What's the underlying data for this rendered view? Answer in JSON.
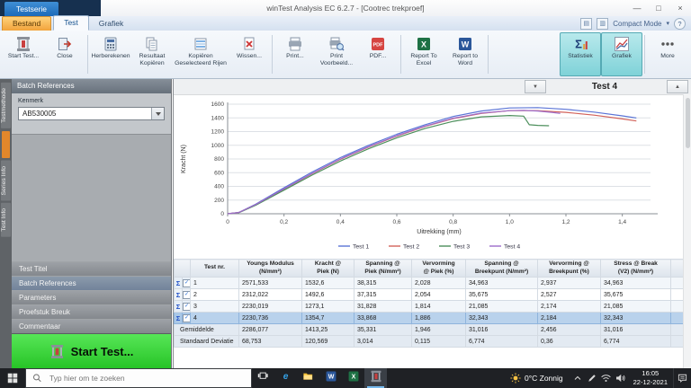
{
  "window": {
    "doc_tab": "Testserie",
    "title": "winTest Analysis EC 6.2.7 - [Cootrec trekproef]",
    "controls": {
      "minimize": "—",
      "maximize": "□",
      "close": "×"
    }
  },
  "ribbon": {
    "tabs": [
      {
        "id": "bestand",
        "label": "Bestand",
        "style": "file"
      },
      {
        "id": "test",
        "label": "Test",
        "active": true
      },
      {
        "id": "grafiek",
        "label": "Grafiek"
      }
    ],
    "right": {
      "compact_mode": "Compact Mode"
    },
    "groups": [
      {
        "buttons": [
          {
            "id": "start-test",
            "label": "Start Test...",
            "icon": "machine"
          },
          {
            "id": "close",
            "label": "Close",
            "icon": "close"
          }
        ]
      },
      {
        "buttons": [
          {
            "id": "herberekenen",
            "label": "Herberekenen",
            "icon": "recalc"
          },
          {
            "id": "resultaat-kopieren",
            "label": "Resultaat Kopiëren",
            "icon": "copy"
          },
          {
            "id": "kopieren-geselecteerd-rijen",
            "label": "Kopiëren Geselecteerd Rijen",
            "icon": "copy-rows"
          },
          {
            "id": "wissen",
            "label": "Wissen...",
            "icon": "delete"
          }
        ]
      },
      {
        "buttons": [
          {
            "id": "print",
            "label": "Print...",
            "icon": "printer"
          },
          {
            "id": "print-voorbeeld",
            "label": "Print Voorbeeld...",
            "icon": "print-preview"
          },
          {
            "id": "pdf",
            "label": "PDF...",
            "icon": "pdf"
          }
        ]
      },
      {
        "buttons": [
          {
            "id": "report-to-excel",
            "label": "Report To Excel",
            "icon": "excel"
          },
          {
            "id": "report-to-word",
            "label": "Report to Word",
            "icon": "word"
          }
        ]
      },
      {
        "buttons": [
          {
            "id": "statistiek",
            "label": "Statistiek",
            "icon": "sigma",
            "active": true
          },
          {
            "id": "grafiek",
            "label": "Grafiek",
            "icon": "chart",
            "active": true
          }
        ]
      },
      {
        "buttons": [
          {
            "id": "more",
            "label": "More",
            "icon": "more"
          }
        ]
      }
    ]
  },
  "side_tabs": {
    "items": [
      {
        "label": "Testmethode"
      },
      {
        "label": "Series Info"
      },
      {
        "label": "Test Info"
      }
    ]
  },
  "left_panel": {
    "header": "Batch References",
    "kenmerk_label": "Kenmerk",
    "kenmerk_value": "AB530005",
    "nav_items": [
      {
        "label": "Test Titel"
      },
      {
        "label": "Batch References",
        "active": true
      },
      {
        "label": "Parameters"
      },
      {
        "label": "Proefstuk Breuk"
      },
      {
        "label": "Commentaar"
      }
    ],
    "start_button": "Start Test..."
  },
  "main": {
    "selected_test": "Test 4",
    "dropdown_icon": "▼",
    "collapse_icon": "▲"
  },
  "chart_data": {
    "type": "line",
    "xlabel": "Uitrekking (mm)",
    "ylabel": "Kracht (N)",
    "xlim": [
      0,
      1.5
    ],
    "ylim": [
      0,
      1600
    ],
    "grid": "horizontal",
    "legend_position": "bottom",
    "x_ticks": [
      0,
      0.2,
      0.4,
      0.6,
      0.8,
      1.0,
      1.2,
      1.4
    ],
    "x_tick_labels": [
      "0",
      "0,2",
      "0,4",
      "0,6",
      "0,8",
      "1,0",
      "1,2",
      "1,4"
    ],
    "y_ticks": [
      0,
      200,
      400,
      600,
      800,
      1000,
      1200,
      1400,
      1600
    ],
    "series": [
      {
        "name": "Test 1",
        "color": "#5b74d6",
        "points": [
          [
            0,
            0
          ],
          [
            0.04,
            20
          ],
          [
            0.1,
            140
          ],
          [
            0.2,
            380
          ],
          [
            0.3,
            610
          ],
          [
            0.4,
            820
          ],
          [
            0.5,
            1000
          ],
          [
            0.6,
            1160
          ],
          [
            0.7,
            1300
          ],
          [
            0.8,
            1420
          ],
          [
            0.9,
            1500
          ],
          [
            1.0,
            1545
          ],
          [
            1.1,
            1550
          ],
          [
            1.2,
            1525
          ],
          [
            1.3,
            1485
          ],
          [
            1.4,
            1430
          ],
          [
            1.45,
            1400
          ]
        ]
      },
      {
        "name": "Test 2",
        "color": "#d2625a",
        "points": [
          [
            0,
            0
          ],
          [
            0.04,
            18
          ],
          [
            0.1,
            130
          ],
          [
            0.2,
            360
          ],
          [
            0.3,
            585
          ],
          [
            0.4,
            795
          ],
          [
            0.5,
            975
          ],
          [
            0.6,
            1135
          ],
          [
            0.7,
            1275
          ],
          [
            0.8,
            1390
          ],
          [
            0.9,
            1465
          ],
          [
            1.0,
            1505
          ],
          [
            1.1,
            1505
          ],
          [
            1.2,
            1480
          ],
          [
            1.3,
            1440
          ],
          [
            1.4,
            1385
          ],
          [
            1.45,
            1355
          ]
        ]
      },
      {
        "name": "Test 3",
        "color": "#4d8f5c",
        "points": [
          [
            0,
            0
          ],
          [
            0.04,
            16
          ],
          [
            0.1,
            125
          ],
          [
            0.2,
            345
          ],
          [
            0.3,
            565
          ],
          [
            0.4,
            770
          ],
          [
            0.5,
            950
          ],
          [
            0.6,
            1110
          ],
          [
            0.7,
            1245
          ],
          [
            0.8,
            1350
          ],
          [
            0.9,
            1415
          ],
          [
            1.0,
            1435
          ],
          [
            1.05,
            1425
          ],
          [
            1.07,
            1300
          ],
          [
            1.1,
            1290
          ],
          [
            1.14,
            1285
          ]
        ]
      },
      {
        "name": "Test 4",
        "color": "#9d6bc9",
        "points": [
          [
            0,
            0
          ],
          [
            0.04,
            18
          ],
          [
            0.1,
            135
          ],
          [
            0.2,
            365
          ],
          [
            0.3,
            590
          ],
          [
            0.4,
            800
          ],
          [
            0.5,
            980
          ],
          [
            0.6,
            1140
          ],
          [
            0.7,
            1280
          ],
          [
            0.8,
            1395
          ],
          [
            0.9,
            1470
          ],
          [
            1.0,
            1505
          ],
          [
            1.05,
            1510
          ],
          [
            1.1,
            1500
          ],
          [
            1.15,
            1480
          ],
          [
            1.18,
            1465
          ]
        ]
      }
    ]
  },
  "table": {
    "columns": [
      {
        "title": "Test nr.",
        "unit": ""
      },
      {
        "title": "Youngs Modulus",
        "unit": "(N/mm²)"
      },
      {
        "title": "Kracht @",
        "unit": "Piek (N)"
      },
      {
        "title": "Spanning @",
        "unit": "Piek (N/mm²)"
      },
      {
        "title": "Vervorming",
        "unit": "@ Piek (%)"
      },
      {
        "title": "Spanning @",
        "unit": "Breekpunt (N/mm²)"
      },
      {
        "title": "Vervorming @",
        "unit": "Breekpunt (%)"
      },
      {
        "title": "Stress @ Break",
        "unit": "(V2)  (N/mm²)"
      }
    ],
    "rows": [
      {
        "nr": "1",
        "values": [
          "2571,533",
          "1532,6",
          "38,315",
          "2,028",
          "34,963",
          "2,937",
          "34,963"
        ]
      },
      {
        "nr": "2",
        "values": [
          "2312,022",
          "1492,6",
          "37,315",
          "2,054",
          "35,675",
          "2,527",
          "35,675"
        ]
      },
      {
        "nr": "3",
        "values": [
          "2230,019",
          "1273,1",
          "31,828",
          "1,814",
          "21,085",
          "2,174",
          "21,085"
        ]
      },
      {
        "nr": "4",
        "values": [
          "2230,736",
          "1354,7",
          "33,868",
          "1,886",
          "32,343",
          "2,184",
          "32,343"
        ],
        "selected": true
      }
    ],
    "summary_rows": [
      {
        "label": "Gemiddelde",
        "values": [
          "2286,077",
          "1413,25",
          "35,331",
          "1,946",
          "31,016",
          "2,456",
          "31,016"
        ]
      },
      {
        "label": "Standaard Deviatie",
        "values": [
          "68,753",
          "120,569",
          "3,014",
          "0,115",
          "6,774",
          "0,36",
          "6,774"
        ]
      }
    ]
  },
  "taskbar": {
    "search_placeholder": "Typ hier om te zoeken",
    "apps": [
      {
        "id": "task-view"
      },
      {
        "id": "edge"
      },
      {
        "id": "explorer"
      },
      {
        "id": "word"
      },
      {
        "id": "excel"
      },
      {
        "id": "wintest",
        "active": true
      }
    ],
    "weather": "0°C Zonnig",
    "time": "16:05",
    "date": "22-12-2021"
  }
}
